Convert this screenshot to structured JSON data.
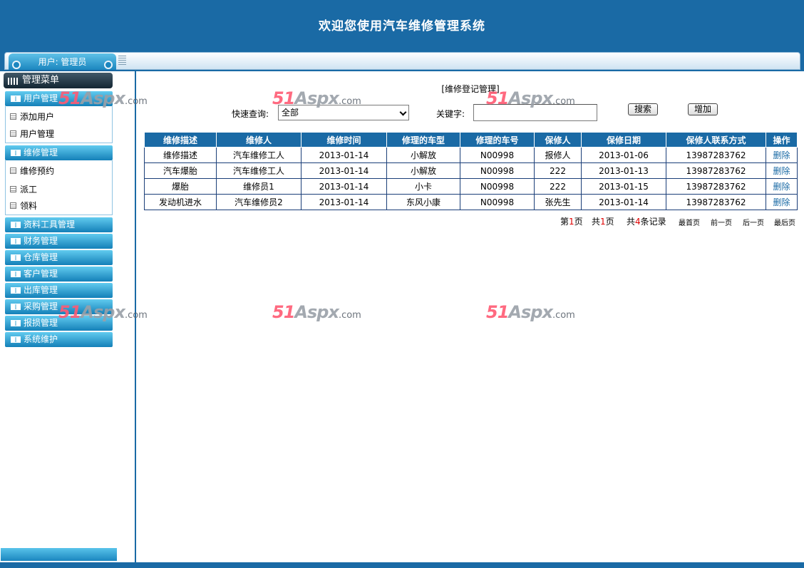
{
  "header": {
    "title": "欢迎您使用汽车维修管理系统"
  },
  "topbar": {
    "user_label": "用户: 管理员"
  },
  "sidebar": {
    "menu_title": "管理菜单",
    "categories": [
      {
        "label": "用户管理",
        "items": [
          "添加用户",
          "用户管理"
        ]
      },
      {
        "label": "维修管理",
        "items": [
          "维修预约",
          "派工",
          "领料"
        ]
      },
      {
        "label": "资料工具管理",
        "items": []
      },
      {
        "label": "财务管理",
        "items": []
      },
      {
        "label": "仓库管理",
        "items": []
      },
      {
        "label": "客户管理",
        "items": []
      },
      {
        "label": "出库管理",
        "items": []
      },
      {
        "label": "采购管理",
        "items": []
      },
      {
        "label": "报损管理",
        "items": []
      },
      {
        "label": "系统维护",
        "items": []
      }
    ]
  },
  "watermark": {
    "brand": "51",
    "mid": "Aspx",
    "suffix": ".com"
  },
  "main": {
    "page_title": "[维修登记管理]",
    "search": {
      "quick_label": "快速查询:",
      "quick_value": "全部",
      "keyword_label": "关键字:",
      "keyword_value": "",
      "search_button": "搜索",
      "add_button": "增加"
    },
    "table": {
      "headers": [
        "维修描述",
        "维修人",
        "维修时间",
        "修理的车型",
        "修理的车号",
        "保修人",
        "保修日期",
        "保修人联系方式",
        "操作"
      ],
      "rows": [
        [
          "维修描述",
          "汽车维修工人",
          "2013-01-14",
          "小解放",
          "N00998",
          "报修人",
          "2013-01-06",
          "13987283762",
          "删除"
        ],
        [
          "汽车爆胎",
          "汽车维修工人",
          "2013-01-14",
          "小解放",
          "N00998",
          "222",
          "2013-01-13",
          "13987283762",
          "删除"
        ],
        [
          "爆胎",
          "维修员1",
          "2013-01-14",
          "小卡",
          "N00998",
          "222",
          "2013-01-15",
          "13987283762",
          "删除"
        ],
        [
          "发动机进水",
          "汽车维修员2",
          "2013-01-14",
          "东风小康",
          "N00998",
          "张先生",
          "2013-01-14",
          "13987283762",
          "删除"
        ]
      ]
    },
    "pager": {
      "page_prefix": "第",
      "current_page": "1",
      "page_suffix": "页",
      "total_prefix": "共",
      "total_pages": "1",
      "total_suffix": "页",
      "records_prefix": "共",
      "records": "4",
      "records_suffix": "条记录",
      "first": "最首页",
      "prev": "前一页",
      "next": "后一页",
      "last": "最后页"
    }
  },
  "colors": {
    "primary": "#1a6aa5",
    "accent_light": "#61cbef",
    "watermark_red": "#ff5a73"
  }
}
